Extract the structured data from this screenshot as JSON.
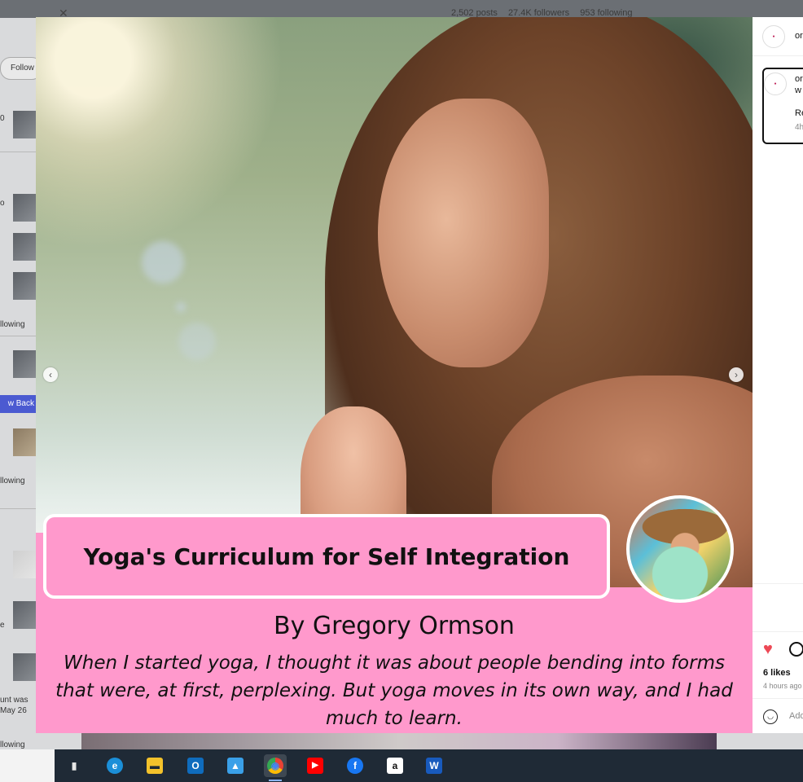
{
  "background_page": {
    "stats": [
      "2,502 posts",
      "27.4K followers",
      "953 following"
    ],
    "follow_pill": "Follow",
    "left_labels": [
      "llowing",
      "w Back",
      "llowing",
      "unt was",
      "May 26",
      "llowing"
    ],
    "edge_chars": [
      "0",
      "o",
      "e"
    ]
  },
  "post": {
    "title": "Yoga's Curriculum for Self Integration",
    "byline": "By Gregory Ormson",
    "excerpt": "When I started yoga, I thought it was about people bending into forms that were, at first, perplexing. But yoga moves in its own way, and I had much to learn.",
    "prev_arrow": "‹",
    "next_arrow": "›"
  },
  "side_panel": {
    "header_user": "or",
    "comment_user": "or",
    "comment_line2": "w",
    "comment_reply": "Re",
    "comment_time": "4h",
    "likes": "6 likes",
    "time": "4 hours ago",
    "add_comment_placeholder": "Add"
  },
  "taskbar": {
    "apps": [
      {
        "name": "task-view",
        "glyph": "▮"
      },
      {
        "name": "edge",
        "glyph": "e",
        "color": "#1b8fd8"
      },
      {
        "name": "file-explorer",
        "glyph": "▬",
        "color": "#f3c22b"
      },
      {
        "name": "outlook",
        "glyph": "O",
        "color": "#0f6cbd"
      },
      {
        "name": "photos",
        "glyph": "▲",
        "color": "#3aa0e8"
      },
      {
        "name": "chrome",
        "glyph": "◉",
        "color": "#e94235"
      },
      {
        "name": "youtube",
        "glyph": "▶",
        "color": "#ff0000"
      },
      {
        "name": "facebook",
        "glyph": "f",
        "color": "#1877f2"
      },
      {
        "name": "amazon",
        "glyph": "a",
        "color": "#ffffff"
      },
      {
        "name": "word",
        "glyph": "W",
        "color": "#185abd"
      }
    ]
  },
  "colors": {
    "banner_pink": "#ff99cc",
    "like_red": "#ed4956",
    "taskbar_bg": "#1f2a36"
  }
}
